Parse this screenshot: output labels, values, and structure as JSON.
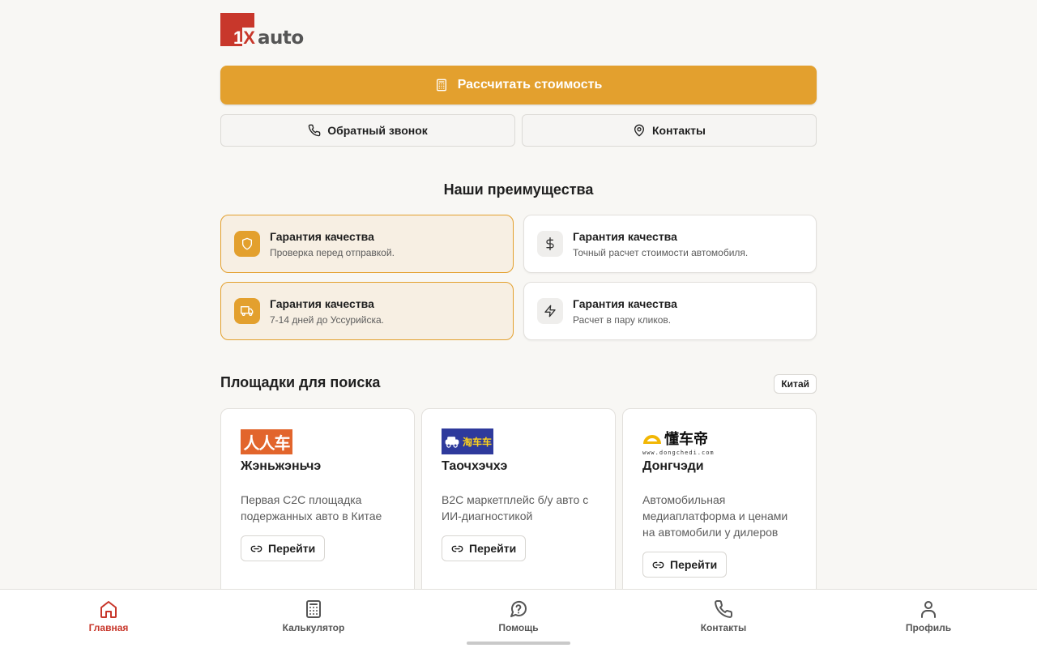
{
  "brand": {
    "logo_text_1": "1",
    "logo_text_x": "X",
    "logo_text_auto": "auto"
  },
  "actions": {
    "calculate_label": "Рассчитать стоимость",
    "callback_label": "Обратный звонок",
    "contacts_label": "Контакты"
  },
  "advantages": {
    "title": "Наши преимущества",
    "items": [
      {
        "title": "Гарантия качества",
        "desc": "Проверка перед отправкой.",
        "icon": "shield-icon",
        "highlighted": true
      },
      {
        "title": "Гарантия качества",
        "desc": "Точный расчет стоимости автомобиля.",
        "icon": "dollar-icon",
        "highlighted": false
      },
      {
        "title": "Гарантия качества",
        "desc": "7-14 дней до Уссурийска.",
        "icon": "truck-icon",
        "highlighted": true
      },
      {
        "title": "Гарантия качества",
        "desc": "Расчет в пару кликов.",
        "icon": "lightning-icon",
        "highlighted": false
      }
    ]
  },
  "platforms": {
    "title": "Площадки для поиска",
    "region": "Китай",
    "items": [
      {
        "name": "Жэньжэньчэ",
        "desc": "Первая C2C площадка подержанных авто в Китае",
        "link_label": "Перейти",
        "logo_text": "人人车"
      },
      {
        "name": "Таочхэчхэ",
        "desc": "B2C маркетплейс б/у авто с ИИ-диагностикой",
        "link_label": "Перейти",
        "logo_text": "淘车车"
      },
      {
        "name": "Донгчэди",
        "desc": "Автомобильная медиаплатформа и ценами на автомобили у дилеров",
        "link_label": "Перейти",
        "logo_text": "懂车帝",
        "logo_url": "www.dongchedi.com"
      }
    ]
  },
  "nav": {
    "items": [
      {
        "label": "Главная",
        "icon": "home-icon",
        "active": true
      },
      {
        "label": "Калькулятор",
        "icon": "calculator-icon",
        "active": false
      },
      {
        "label": "Помощь",
        "icon": "help-icon",
        "active": false
      },
      {
        "label": "Контакты",
        "icon": "phone-icon",
        "active": false
      },
      {
        "label": "Профиль",
        "icon": "profile-icon",
        "active": false
      }
    ]
  },
  "colors": {
    "accent": "#e3a02e",
    "brand_red": "#c8372b",
    "background": "#f8f7f4"
  }
}
